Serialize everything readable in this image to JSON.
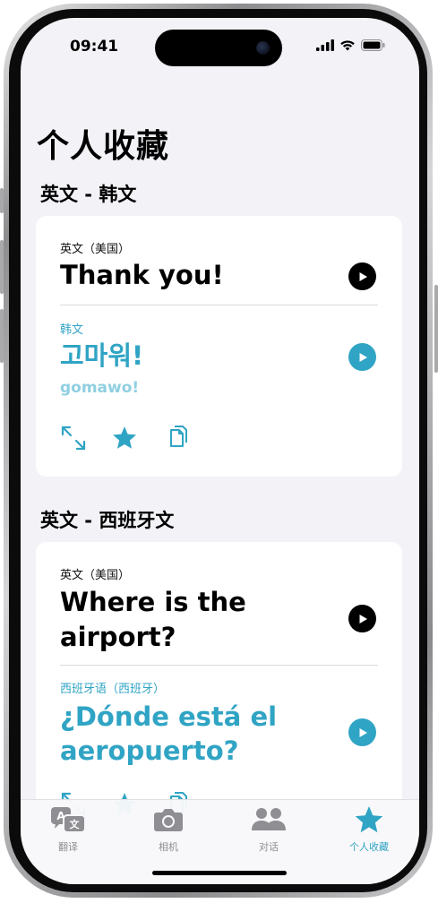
{
  "status_bar": {
    "time": "09:41"
  },
  "page_title": "个人收藏",
  "groups": [
    {
      "title": "英文 - 韩文",
      "source_lang": "英文（美国）",
      "source_text": "Thank you!",
      "target_lang": "韩文",
      "target_text": "고마워!",
      "romanization": "gomawo!"
    },
    {
      "title": "英文 - 西班牙文",
      "source_lang": "英文（美国）",
      "source_text_lines": [
        "Where is the",
        "airport?"
      ],
      "target_lang": "西班牙语（西班牙）",
      "target_text_lines": [
        "¿Dónde está el",
        "aeropuerto?"
      ]
    }
  ],
  "tabs": [
    {
      "label": "翻译",
      "icon": "translate-icon"
    },
    {
      "label": "相机",
      "icon": "camera-icon"
    },
    {
      "label": "对话",
      "icon": "conversation-icon"
    },
    {
      "label": "个人收藏",
      "icon": "star-icon",
      "active": true
    }
  ],
  "colors": {
    "accent": "#30a4c4",
    "background": "#f2f2f7",
    "card": "#ffffff",
    "inactive": "#8e8e93"
  }
}
